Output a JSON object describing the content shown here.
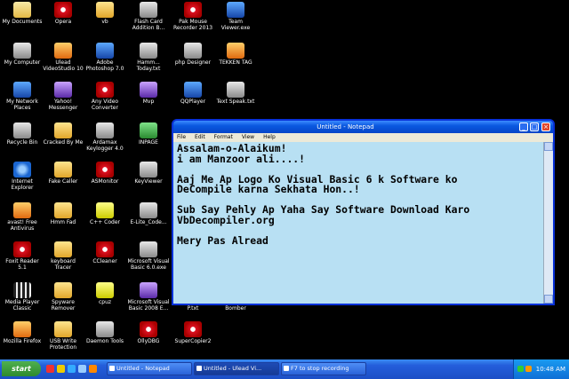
{
  "desktop": {
    "icons": [
      {
        "label": "My Documents",
        "glyph": "g-doc"
      },
      {
        "label": "Opera",
        "glyph": "g-red"
      },
      {
        "label": "vb",
        "glyph": "g-fold"
      },
      {
        "label": "Flash Card\nAddition B...",
        "glyph": "g-gray"
      },
      {
        "label": "Pak Mouse\nRecorder 2013",
        "glyph": "g-red"
      },
      {
        "label": "Team\nViewer.exe",
        "glyph": "g-blue"
      },
      {
        "label": "My Computer",
        "glyph": "g-gray"
      },
      {
        "label": "Ulead\nVideoStudio 10",
        "glyph": "g-orange"
      },
      {
        "label": "Adobe\nPhotoshop 7.0",
        "glyph": "g-blue"
      },
      {
        "label": "Hamm...\nToday.txt",
        "glyph": "g-gray"
      },
      {
        "label": "php Designer",
        "glyph": "g-gray"
      },
      {
        "label": "TEKKEN TAG",
        "glyph": "g-orange"
      },
      {
        "label": "My Network\nPlaces",
        "glyph": "g-blue"
      },
      {
        "label": "Yahoo!\nMessenger",
        "glyph": "g-purple"
      },
      {
        "label": "Any Video\nConverter",
        "glyph": "g-red"
      },
      {
        "label": "Mvp",
        "glyph": "g-purple"
      },
      {
        "label": "QQPlayer",
        "glyph": "g-blue"
      },
      {
        "label": "Text Speak.txt",
        "glyph": "g-gray"
      },
      {
        "label": "Recycle Bin",
        "glyph": "g-gray"
      },
      {
        "label": "Cracked By Me",
        "glyph": "g-fold"
      },
      {
        "label": "Ardamax\nKeylogger 4.0",
        "glyph": "g-gray"
      },
      {
        "label": "INPAGE",
        "glyph": "g-green"
      },
      {
        "label": "Internet\nExplorer",
        "glyph": "g-ie"
      },
      {
        "label": "Fake Caller",
        "glyph": "g-fold"
      },
      {
        "label": "ASMonitor",
        "glyph": "g-red"
      },
      {
        "label": "KeyViewer",
        "glyph": "g-gray"
      },
      {
        "label": "avast! Free\nAntivirus",
        "glyph": "g-orange"
      },
      {
        "label": "Hmm Fad",
        "glyph": "g-fold"
      },
      {
        "label": "C++ Coder",
        "glyph": "g-yellow"
      },
      {
        "label": "E-Lite_Code...",
        "glyph": "g-gray"
      },
      {
        "label": "Foxit Reader\n5.1",
        "glyph": "g-red"
      },
      {
        "label": "keyboard\nTracer",
        "glyph": "g-fold"
      },
      {
        "label": "CCleaner",
        "glyph": "g-red"
      },
      {
        "label": "Microsoft Visual\nBasic 6.0.exe",
        "glyph": "g-gray"
      },
      {
        "label": "Media Player\nClassic",
        "glyph": "g-film"
      },
      {
        "label": "Spyware\nRemover",
        "glyph": "g-fold"
      },
      {
        "label": "cpuz",
        "glyph": "g-yellow"
      },
      {
        "label": "Microsoft Visual\nBasic 2008 E...",
        "glyph": "g-purple"
      },
      {
        "label": "SMS Bomber\nP.txt",
        "glyph": "g-gray"
      },
      {
        "label": "Zong SMS\nBomber",
        "glyph": "g-red"
      },
      {
        "label": "Mozilla Firefox",
        "glyph": "g-orange"
      },
      {
        "label": "USB Write\nProtection",
        "glyph": "g-fold"
      },
      {
        "label": "Daemon Tools",
        "glyph": "g-gray"
      },
      {
        "label": "OllyDBG",
        "glyph": "g-red"
      },
      {
        "label": "SuperCopier2",
        "glyph": "g-red"
      }
    ]
  },
  "notepad": {
    "title": "Untitled - Notepad",
    "menu": [
      "File",
      "Edit",
      "Format",
      "View",
      "Help"
    ],
    "text": "Assalam-o-Alaikum!\ni am Manzoor ali....!\n\nAaj Me Ap Logo Ko Visual Basic 6 k Software ko\nDeCompile karna Sekhata Hon..!\n\nSub Say Pehly Ap Yaha Say Software Download Karo\nVbDecompiler.org\n\nMery Pas Alread"
  },
  "taskbar": {
    "start_label": "start",
    "buttons": [
      {
        "label": "Untitled - Notepad",
        "active": false
      },
      {
        "label": "Untitled - Ulead Vi...",
        "active": true
      },
      {
        "label": "F7 to stop recording",
        "active": false
      }
    ],
    "clock": "10:48 AM"
  }
}
